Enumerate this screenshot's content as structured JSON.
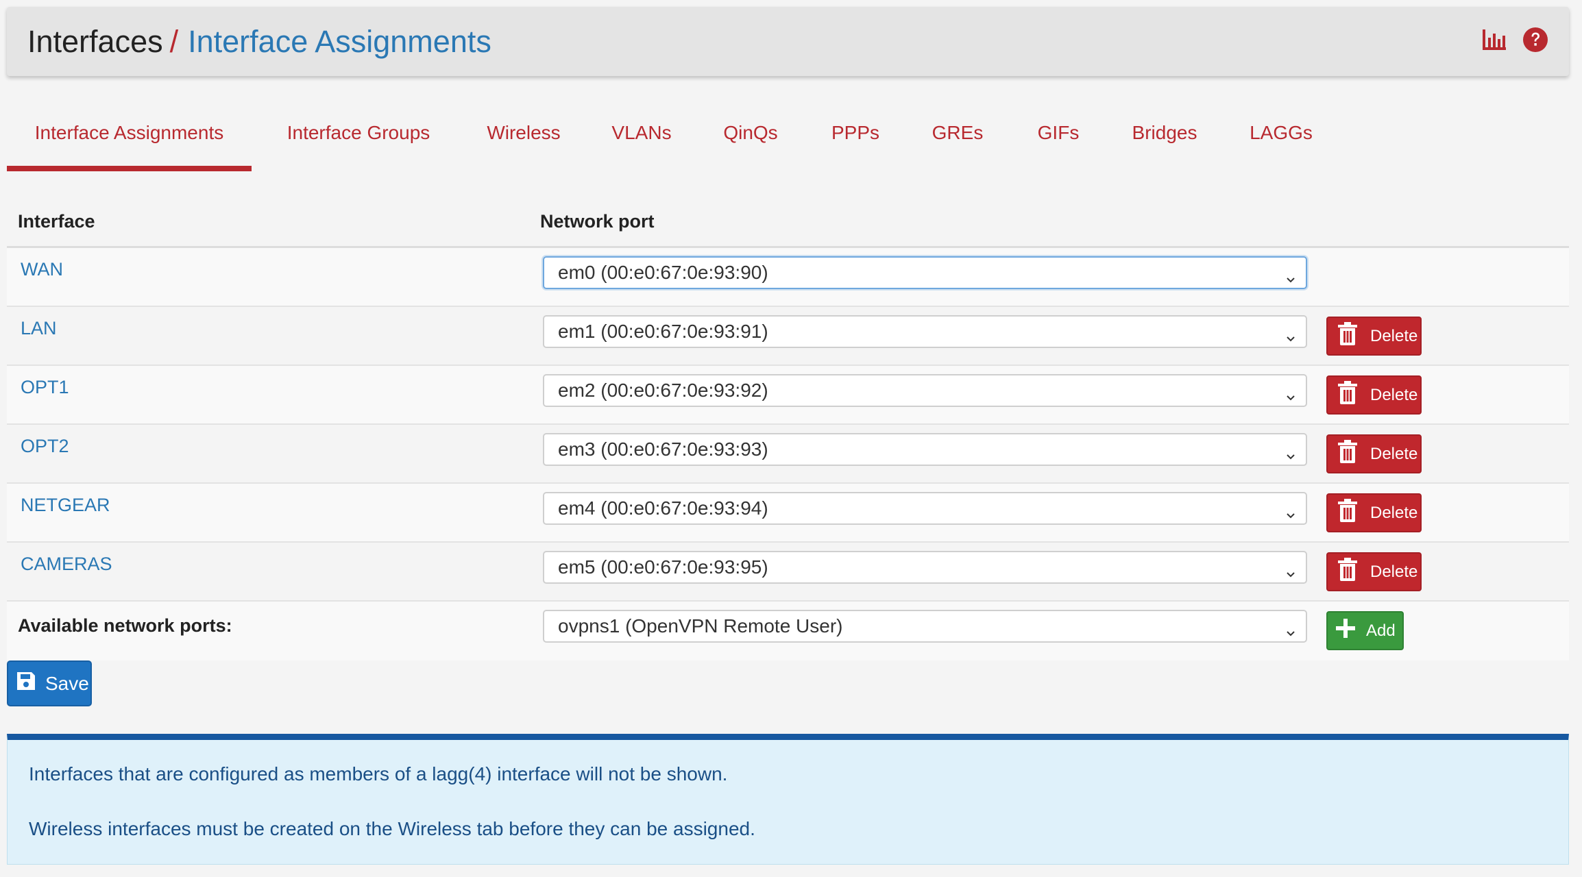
{
  "header": {
    "breadcrumb_root": "Interfaces",
    "breadcrumb_sep": "/",
    "breadcrumb_current": "Interface Assignments",
    "icons": [
      "bar-chart-icon",
      "help-icon"
    ]
  },
  "tabs": [
    {
      "label": "Interface Assignments",
      "active": true
    },
    {
      "label": "Interface Groups",
      "active": false
    },
    {
      "label": "Wireless",
      "active": false
    },
    {
      "label": "VLANs",
      "active": false
    },
    {
      "label": "QinQs",
      "active": false
    },
    {
      "label": "PPPs",
      "active": false
    },
    {
      "label": "GREs",
      "active": false
    },
    {
      "label": "GIFs",
      "active": false
    },
    {
      "label": "Bridges",
      "active": false
    },
    {
      "label": "LAGGs",
      "active": false
    }
  ],
  "table": {
    "col_interface": "Interface",
    "col_network_port": "Network port",
    "rows": [
      {
        "interface": "WAN",
        "port": "em0 (00:e0:67:0e:93:90)",
        "delete": ""
      },
      {
        "interface": "LAN",
        "port": "em1 (00:e0:67:0e:93:91)",
        "delete": "Delete"
      },
      {
        "interface": "OPT1",
        "port": "em2 (00:e0:67:0e:93:92)",
        "delete": "Delete"
      },
      {
        "interface": "OPT2",
        "port": "em3 (00:e0:67:0e:93:93)",
        "delete": "Delete"
      },
      {
        "interface": "NETGEAR",
        "port": "em4 (00:e0:67:0e:93:94)",
        "delete": "Delete"
      },
      {
        "interface": "CAMERAS",
        "port": "em5 (00:e0:67:0e:93:95)",
        "delete": "Delete"
      }
    ],
    "available_label": "Available network ports:",
    "available_port": "ovpns1 (OpenVPN Remote User)",
    "add_label": "Add"
  },
  "save_label": "Save",
  "info": {
    "line1": "Interfaces that are configured as members of a lagg(4) interface will not be shown.",
    "line2": "Wireless interfaces must be created on the Wireless tab before they can be assigned."
  },
  "colors": {
    "accent_red": "#b8292f",
    "link_blue": "#2a78b4",
    "delete_red": "#c0272d",
    "add_green": "#3a9a3e",
    "save_blue": "#1f74c2",
    "info_bg": "#dff1fa",
    "info_border": "#1758a0"
  }
}
